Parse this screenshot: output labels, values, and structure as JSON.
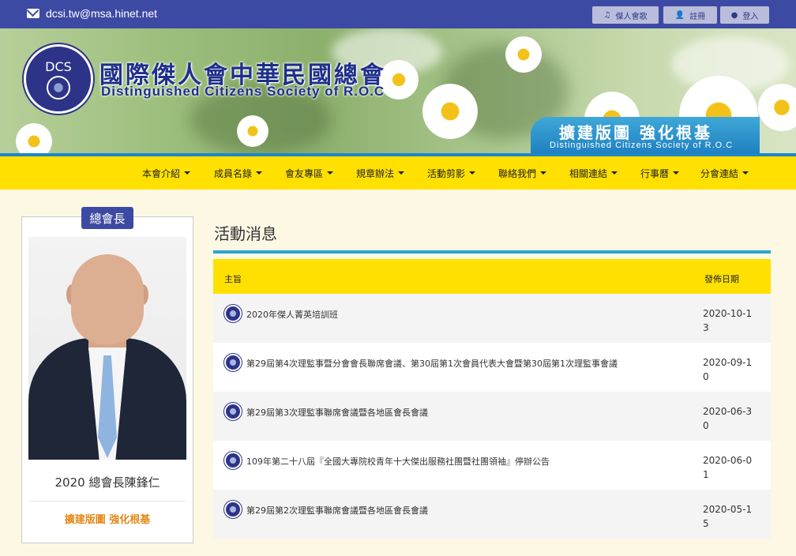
{
  "topbar": {
    "email": "dcsi.tw@msa.hinet.net",
    "buttons": [
      {
        "icon": "music-note-icon",
        "label": "傑人會歌"
      },
      {
        "icon": "user-add-icon",
        "label": "註冊"
      },
      {
        "icon": "user-icon",
        "label": "登入"
      }
    ]
  },
  "banner": {
    "logo_text": "DCS",
    "org_name_cn": "國際傑人會中華民國總會",
    "org_name_en": "Distinguished Citizens Society of R.O.C",
    "slogan_cn": "擴建版圖  強化根基",
    "slogan_en": "Distinguished Citizens Society of R.O.C"
  },
  "nav": {
    "items": [
      "本會介紹",
      "成員名錄",
      "會友專區",
      "規章辦法",
      "活動剪影",
      "聯絡我們",
      "相關連結",
      "行事曆",
      "分會連結"
    ]
  },
  "president_card": {
    "badge": "總會長",
    "name": "2020 總會長陳鋒仁",
    "slogan": "擴建版圖 強化根基"
  },
  "news": {
    "section_title": "活動消息",
    "col_subject": "主旨",
    "col_date": "發佈日期",
    "rows": [
      {
        "subject": "2020年傑人菁英培訓班",
        "date": "2020-10-13"
      },
      {
        "subject": "第29屆第4次理監事暨分會會長聯席會議、第30屆第1次會員代表大會暨第30屆第1次理監事會議",
        "date": "2020-09-10"
      },
      {
        "subject": "第29屆第3次理監事聯席會議暨各地區會長會議",
        "date": "2020-06-30"
      },
      {
        "subject": "109年第二十八屆『全國大專院校青年十大傑出服務社團暨社團領袖』停辦公告",
        "date": "2020-06-01"
      },
      {
        "subject": "第29屆第2次理監事聯席會議暨各地區會長會議",
        "date": "2020-05-15"
      }
    ]
  },
  "colors": {
    "topbar": "#3d4aa3",
    "nav": "#ffe000",
    "accent_line": "#29a7cd",
    "slogan_orange": "#e28a1b"
  }
}
